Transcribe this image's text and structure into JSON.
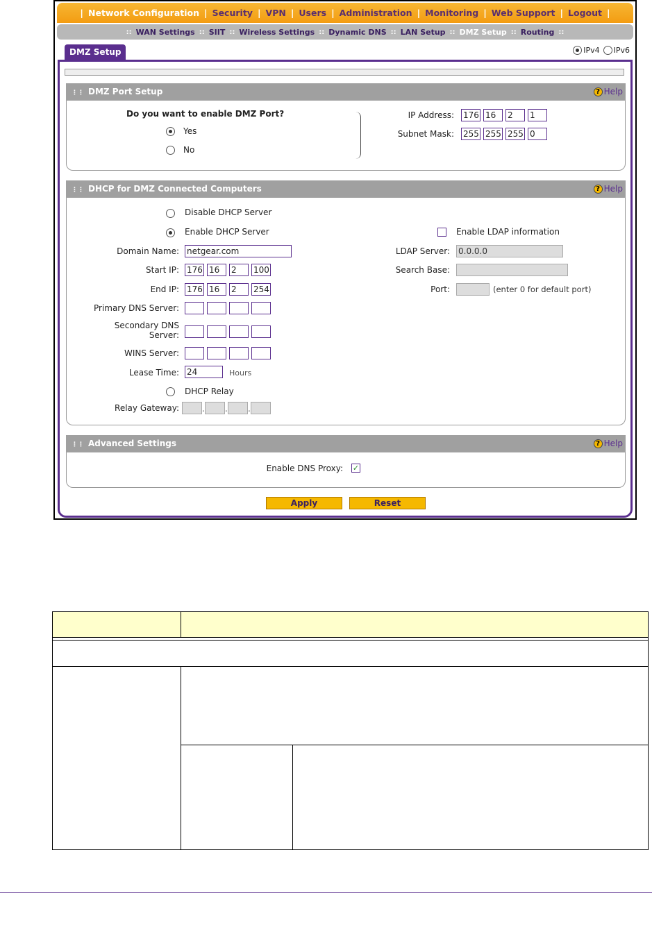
{
  "top_nav": {
    "items": [
      "Network Configuration",
      "Security",
      "VPN",
      "Users",
      "Administration",
      "Monitoring",
      "Web Support",
      "Logout"
    ],
    "active": "Network Configuration"
  },
  "sub_nav": {
    "items": [
      "WAN Settings",
      "SIIT",
      "Wireless Settings",
      "Dynamic DNS",
      "LAN Setup",
      "DMZ Setup",
      "Routing"
    ],
    "active": "DMZ Setup"
  },
  "tab_label": "DMZ Setup",
  "ip_version": {
    "ipv4": "IPv4",
    "ipv6": "IPv6",
    "selected": "IPv4"
  },
  "help_label": "Help",
  "dmz_port": {
    "title": "DMZ Port Setup",
    "question": "Do you want to enable DMZ Port?",
    "yes": "Yes",
    "no": "No",
    "selected": "Yes",
    "ip_label": "IP Address:",
    "ip": [
      "176",
      "16",
      "2",
      "1"
    ],
    "mask_label": "Subnet Mask:",
    "mask": [
      "255",
      "255",
      "255",
      "0"
    ]
  },
  "dhcp": {
    "title": "DHCP for DMZ Connected Computers",
    "disable": "Disable DHCP Server",
    "enable": "Enable DHCP Server",
    "relay": "DHCP Relay",
    "selected": "Enable DHCP Server",
    "domain_label": "Domain Name:",
    "domain": "netgear.com",
    "start_label": "Start IP:",
    "start": [
      "176",
      "16",
      "2",
      "100"
    ],
    "end_label": "End IP:",
    "end": [
      "176",
      "16",
      "2",
      "254"
    ],
    "pdns_label": "Primary DNS Server:",
    "sdns_label_1": "Secondary DNS",
    "sdns_label_2": "Server:",
    "wins_label": "WINS Server:",
    "lease_label": "Lease Time:",
    "lease": "24",
    "lease_unit": "Hours",
    "relay_gw_label": "Relay Gateway:",
    "ldap_check": "Enable LDAP information",
    "ldap_server_label": "LDAP Server:",
    "ldap_server": "0.0.0.0",
    "search_base_label": "Search Base:",
    "port_label": "Port:",
    "port_hint": "(enter 0 for default port)"
  },
  "advanced": {
    "title": "Advanced Settings",
    "dns_proxy_label": "Enable DNS Proxy:",
    "dns_proxy": true
  },
  "buttons": {
    "apply": "Apply",
    "reset": "Reset"
  }
}
